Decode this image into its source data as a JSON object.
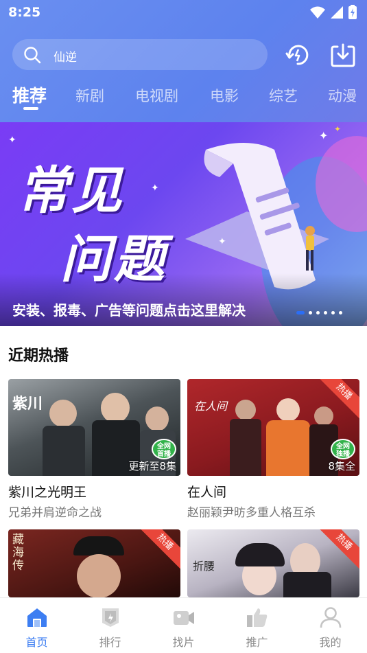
{
  "status": {
    "time": "8:25"
  },
  "search": {
    "query": "仙逆"
  },
  "tabs": [
    {
      "label": "推荐",
      "active": true
    },
    {
      "label": "新剧"
    },
    {
      "label": "电视剧"
    },
    {
      "label": "电影"
    },
    {
      "label": "综艺"
    },
    {
      "label": "动漫"
    }
  ],
  "banner": {
    "title_line1": "常见",
    "title_line2": "问题",
    "caption": "安装、报毒、广告等问题点击这里解决",
    "active_slide_index": 0,
    "slide_count": 6
  },
  "section": {
    "title": "近期热播"
  },
  "cards": [
    {
      "title": "紫川之光明王",
      "subtitle": "兄弟并肩逆命之战",
      "badge": "更新至8集",
      "logo_text": "紫川",
      "tag": "全网首播"
    },
    {
      "title": "在人间",
      "subtitle": "赵丽颖尹昉多重人格互杀",
      "badge": "8集全",
      "logo_text": "在人间",
      "ribbon": "热播",
      "tag": "全网独播"
    },
    {
      "logo_text": "藏海传",
      "ribbon": "热播"
    },
    {
      "logo_text": "折腰",
      "ribbon": "热播"
    }
  ],
  "nav": [
    {
      "label": "首页",
      "icon": "home-icon",
      "active": true
    },
    {
      "label": "排行",
      "icon": "ranking-icon"
    },
    {
      "label": "找片",
      "icon": "video-camera-icon"
    },
    {
      "label": "推广",
      "icon": "share-icon"
    },
    {
      "label": "我的",
      "icon": "user-icon"
    }
  ],
  "colors": {
    "header": "#6a8ff0",
    "accent": "#3d7ef2",
    "ribbon": "#e8463a",
    "banner": "#7a3cf5"
  }
}
